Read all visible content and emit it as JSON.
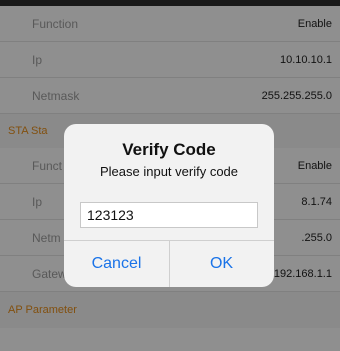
{
  "nav": {
    "back_glyph": "<"
  },
  "rows": [
    {
      "label": "Function",
      "value": "Enable"
    },
    {
      "label": "Ip",
      "value": "10.10.10.1"
    },
    {
      "label": "Netmask",
      "value": "255.255.255.0"
    },
    {
      "label": "STA Sta",
      "value": ""
    },
    {
      "label": "Funct",
      "value": "Enable"
    },
    {
      "label": "Ip",
      "value": "8.1.74"
    },
    {
      "label": "Netm",
      "value": ".255.0"
    },
    {
      "label": "Gateway",
      "value": "192.168.1.1"
    },
    {
      "label": "AP Parameter",
      "value": ""
    }
  ],
  "dialog": {
    "title": "Verify Code",
    "message": "Please input verify code",
    "input_value": "123123",
    "cancel_label": "Cancel",
    "ok_label": "OK"
  },
  "colors": {
    "section_text": "#e08a1a",
    "dialog_button": "#1a73e8",
    "topbar": "#2b2b2b"
  }
}
